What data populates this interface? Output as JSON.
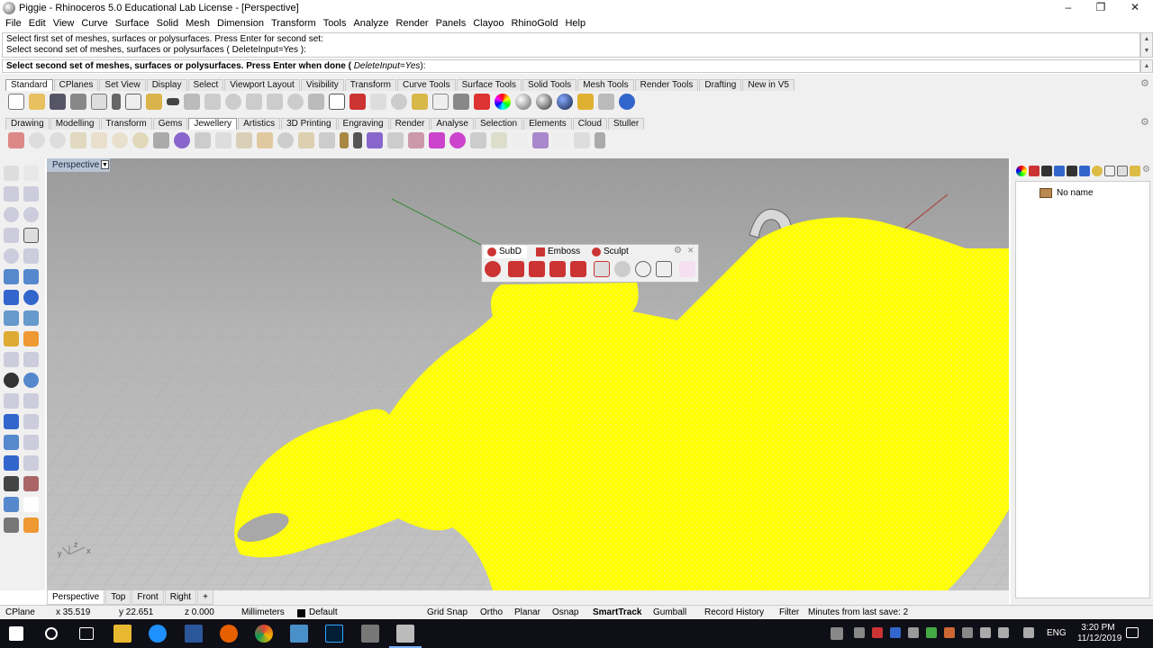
{
  "window": {
    "title": "Piggie - Rhinoceros 5.0 Educational Lab License - [Perspective]",
    "minimize": "–",
    "maximize": "❐",
    "close": "✕"
  },
  "menu": [
    "File",
    "Edit",
    "View",
    "Curve",
    "Surface",
    "Solid",
    "Mesh",
    "Dimension",
    "Transform",
    "Tools",
    "Analyze",
    "Render",
    "Panels",
    "Clayoo",
    "RhinoGold",
    "Help"
  ],
  "command": {
    "history_1": "Select first set of meshes, surfaces or polysurfaces. Press Enter for second set:",
    "history_2": "Select second set of meshes, surfaces or polysurfaces ( DeleteInput=Yes ):",
    "prompt": "Select second set of meshes, surfaces or polysurfaces. Press Enter when done (",
    "option_name": "DeleteInput=",
    "option_value": "Yes",
    "prompt_end": "):"
  },
  "toolbar_tabs_1": [
    "Standard",
    "CPlanes",
    "Set View",
    "Display",
    "Select",
    "Viewport Layout",
    "Visibility",
    "Transform",
    "Curve Tools",
    "Surface Tools",
    "Solid Tools",
    "Mesh Tools",
    "Render Tools",
    "Drafting",
    "New in V5"
  ],
  "toolbar_tabs_2": [
    "Drawing",
    "Modelling",
    "Transform",
    "Gems",
    "Jewellery",
    "Artistics",
    "3D Printing",
    "Engraving",
    "Render",
    "Analyse",
    "Selection",
    "Elements",
    "Cloud",
    "Stuller"
  ],
  "viewport": {
    "title": "Perspective",
    "axis_x": "x",
    "axis_y": "y",
    "axis_z": "z"
  },
  "floating_toolbar": {
    "tabs": [
      "SubD",
      "Emboss",
      "Sculpt"
    ]
  },
  "layers_panel": {
    "item": "No name"
  },
  "viewport_tabs": [
    "Perspective",
    "Top",
    "Front",
    "Right",
    "+"
  ],
  "status": {
    "cplane": "CPlane",
    "x": "x 35.519",
    "y": "y 22.651",
    "z": "z 0.000",
    "units": "Millimeters",
    "layer": "Default",
    "grid_snap": "Grid Snap",
    "ortho": "Ortho",
    "planar": "Planar",
    "osnap": "Osnap",
    "smarttrack": "SmartTrack",
    "gumball": "Gumball",
    "record_history": "Record History",
    "filter": "Filter",
    "save_info": "Minutes from last save: 2"
  },
  "taskbar": {
    "lang": "ENG",
    "time": "3:20 PM",
    "date": "11/12/2019"
  },
  "colors": {
    "mesh": "#ffff00",
    "viewport_bg": "#b4b4b4",
    "taskbar": "#0f0f17",
    "active_status": "#000000"
  }
}
